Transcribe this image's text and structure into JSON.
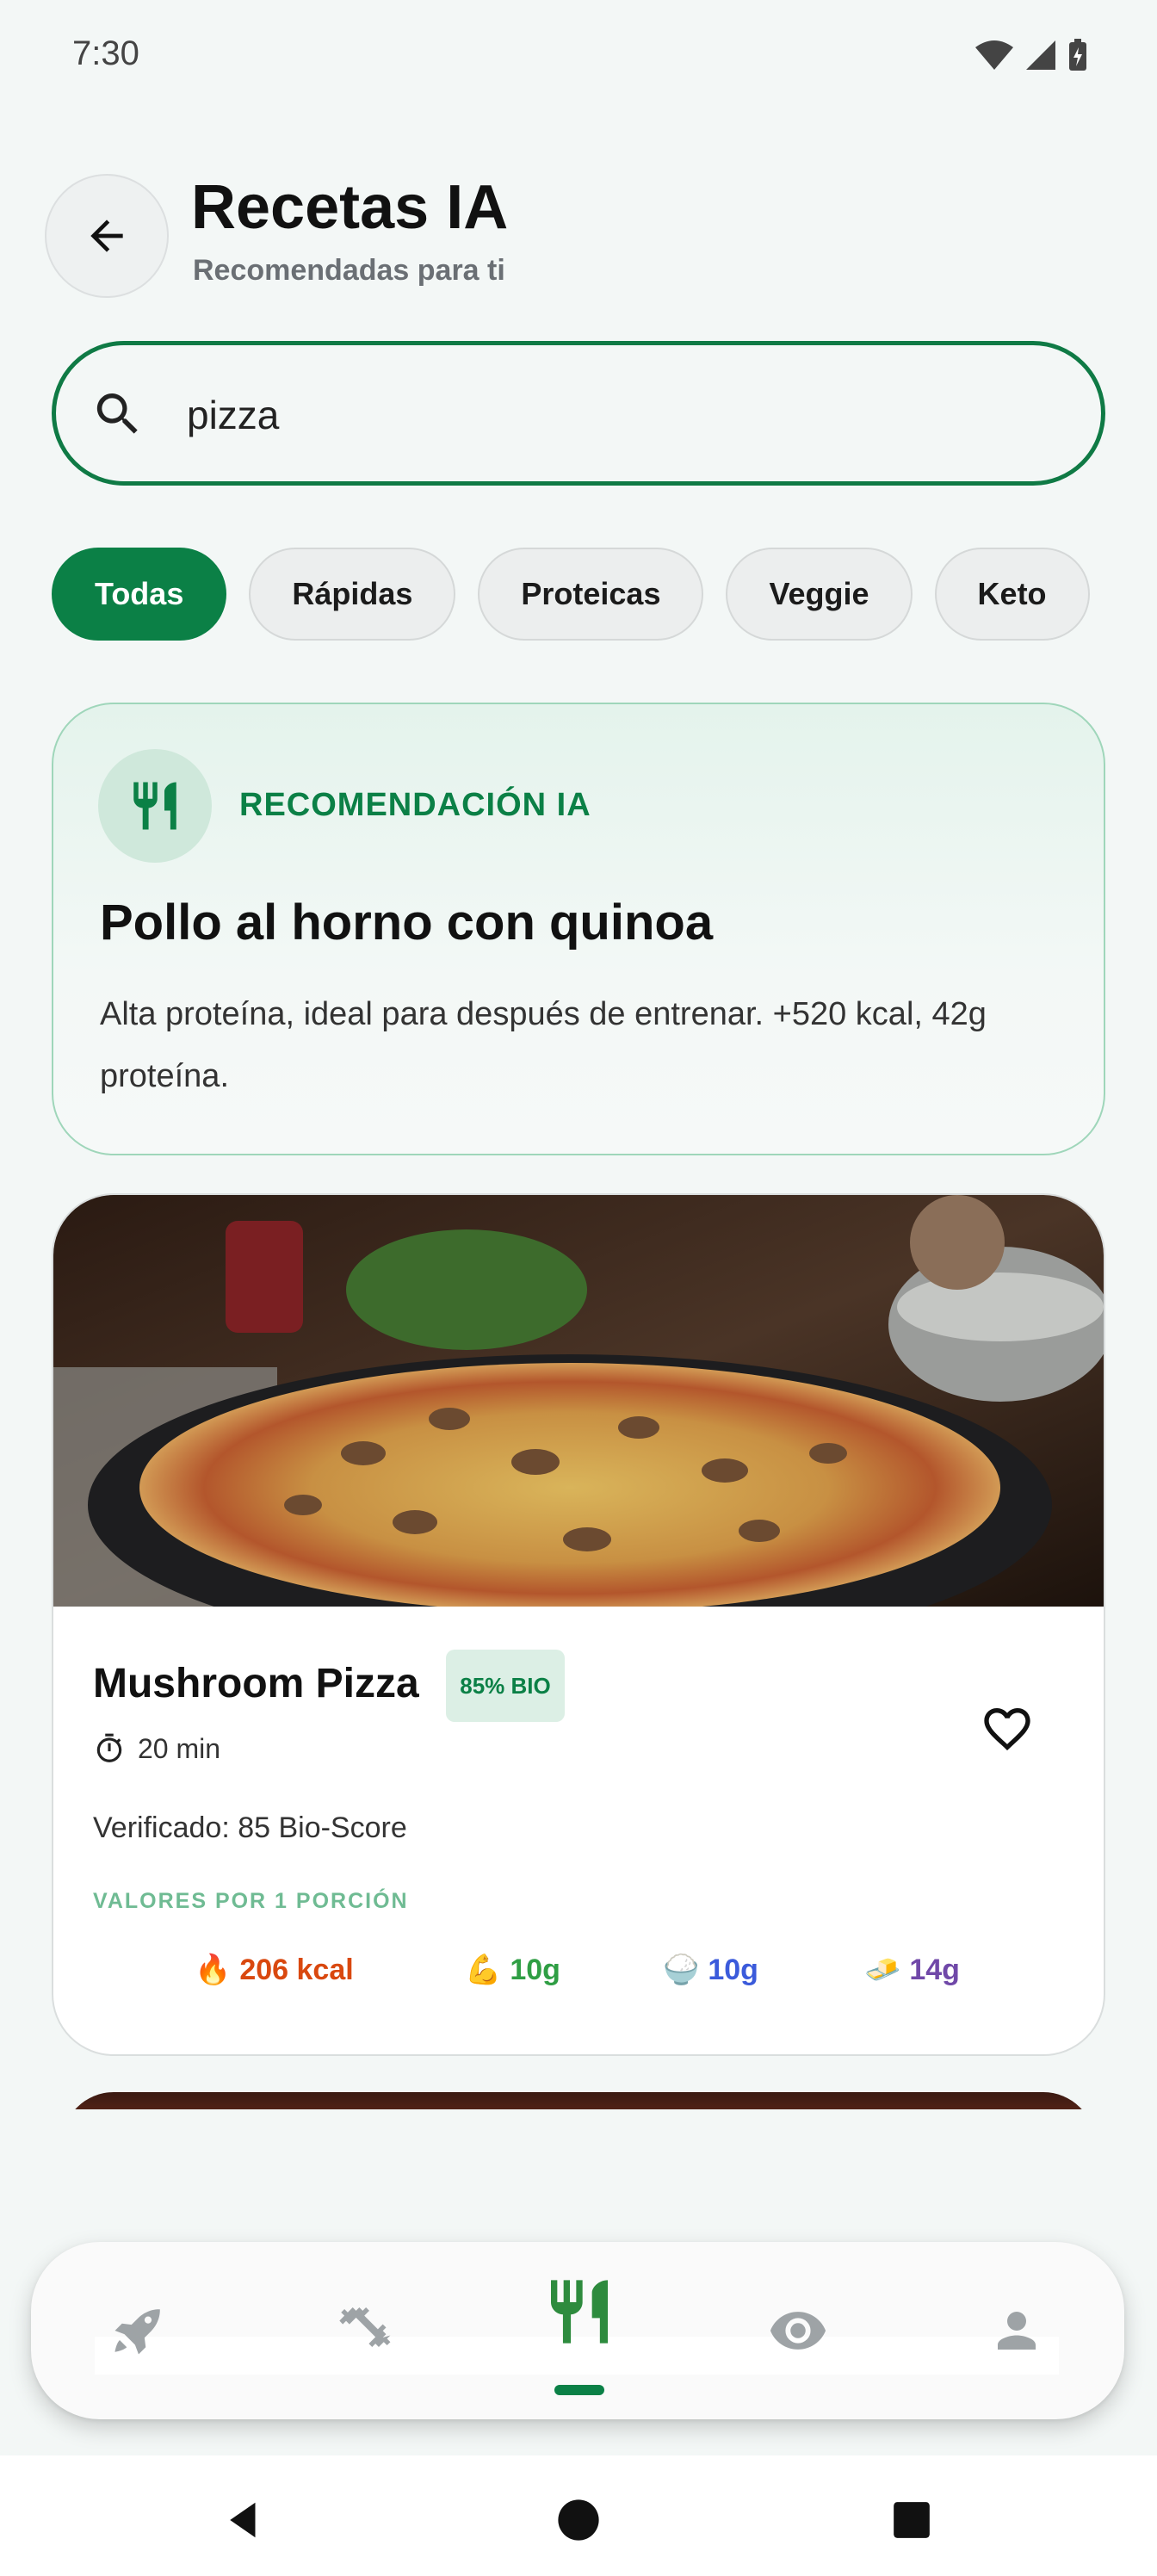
{
  "status_bar": {
    "time": "7:30"
  },
  "header": {
    "title": "Recetas IA",
    "subtitle": "Recomendadas para ti"
  },
  "search": {
    "value": "pizza",
    "placeholder": ""
  },
  "filters": [
    {
      "label": "Todas",
      "active": true
    },
    {
      "label": "Rápidas",
      "active": false
    },
    {
      "label": "Proteicas",
      "active": false
    },
    {
      "label": "Veggie",
      "active": false
    },
    {
      "label": "Keto",
      "active": false
    }
  ],
  "ai_recommendation": {
    "tag": "RECOMENDACIÓN IA",
    "title": "Pollo al horno con quinoa",
    "description": "Alta proteína, ideal para después de entrenar. +520 kcal, 42g proteína."
  },
  "recipes": [
    {
      "name": "Mushroom Pizza",
      "badge": "85% BIO",
      "time": "20 min",
      "verified": "Verificado: 85 Bio-Score",
      "values_label": "VALORES POR 1 PORCIÓN",
      "macros": [
        {
          "icon": "🔥",
          "value": "206 kcal",
          "color": "#d9480f"
        },
        {
          "icon": "💪",
          "value": "10g",
          "color": "#2f9e44"
        },
        {
          "icon": "🍚",
          "value": "10g",
          "color": "#3b5bdb"
        },
        {
          "icon": "🧈",
          "value": "14g",
          "color": "#7048a8"
        }
      ]
    }
  ],
  "bottom_nav": {
    "items": [
      {
        "icon": "rocket-icon",
        "active": false
      },
      {
        "icon": "dumbbell-icon",
        "active": false
      },
      {
        "icon": "fork-knife-icon",
        "active": true
      },
      {
        "icon": "eye-icon",
        "active": false
      },
      {
        "icon": "person-icon",
        "active": false
      }
    ]
  },
  "colors": {
    "brand": "#0b8046",
    "background": "#f3f7f6",
    "inactive_icon": "#9ea3a6"
  }
}
